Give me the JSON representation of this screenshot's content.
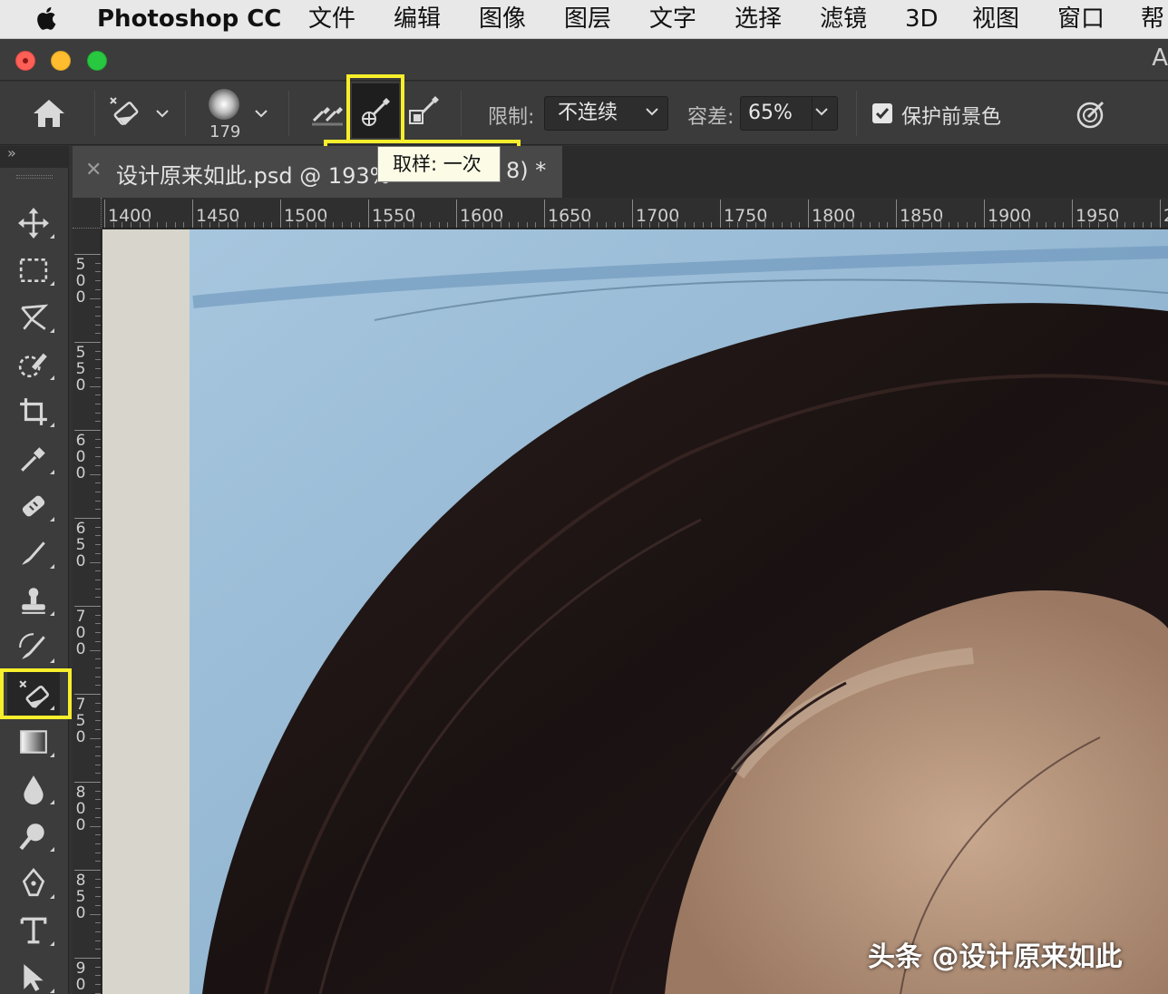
{
  "menubar": {
    "app_name": "Photoshop CC",
    "items": [
      "文件",
      "编辑",
      "图像",
      "图层",
      "文字",
      "选择",
      "滤镜",
      "3D",
      "视图",
      "窗口",
      "帮"
    ]
  },
  "titlebar": {
    "right_text": "A"
  },
  "options": {
    "brush_size": "179",
    "limits_label": "限制:",
    "limits_value": "不连续",
    "tolerance_label": "容差:",
    "tolerance_value": "65%",
    "protect_label": "保护前景色",
    "protect_checked": true,
    "tooltip": "取样: 一次"
  },
  "document": {
    "title": "设计原来如此.psd @ 193%",
    "title_tail": "8) *"
  },
  "rulers": {
    "horizontal": [
      "1400",
      "1450",
      "1500",
      "1550",
      "1600",
      "1650",
      "1700",
      "1750",
      "1800",
      "1850",
      "1900",
      "1950",
      "2"
    ],
    "vertical": [
      "500",
      "550",
      "600",
      "650",
      "700",
      "750",
      "800",
      "850",
      "90"
    ]
  },
  "tools": [
    "move",
    "marquee",
    "lasso",
    "quick-selection",
    "crop",
    "eyedropper",
    "healing-brush",
    "brush",
    "clone-stamp",
    "history-brush",
    "background-eraser",
    "gradient",
    "blur",
    "dodge",
    "pen",
    "type",
    "path-selection"
  ],
  "active_tool": "background-eraser",
  "watermark": "头条 @设计原来如此",
  "colors": {
    "highlight": "#f7ee2c",
    "sky": "#8fb3d1"
  }
}
